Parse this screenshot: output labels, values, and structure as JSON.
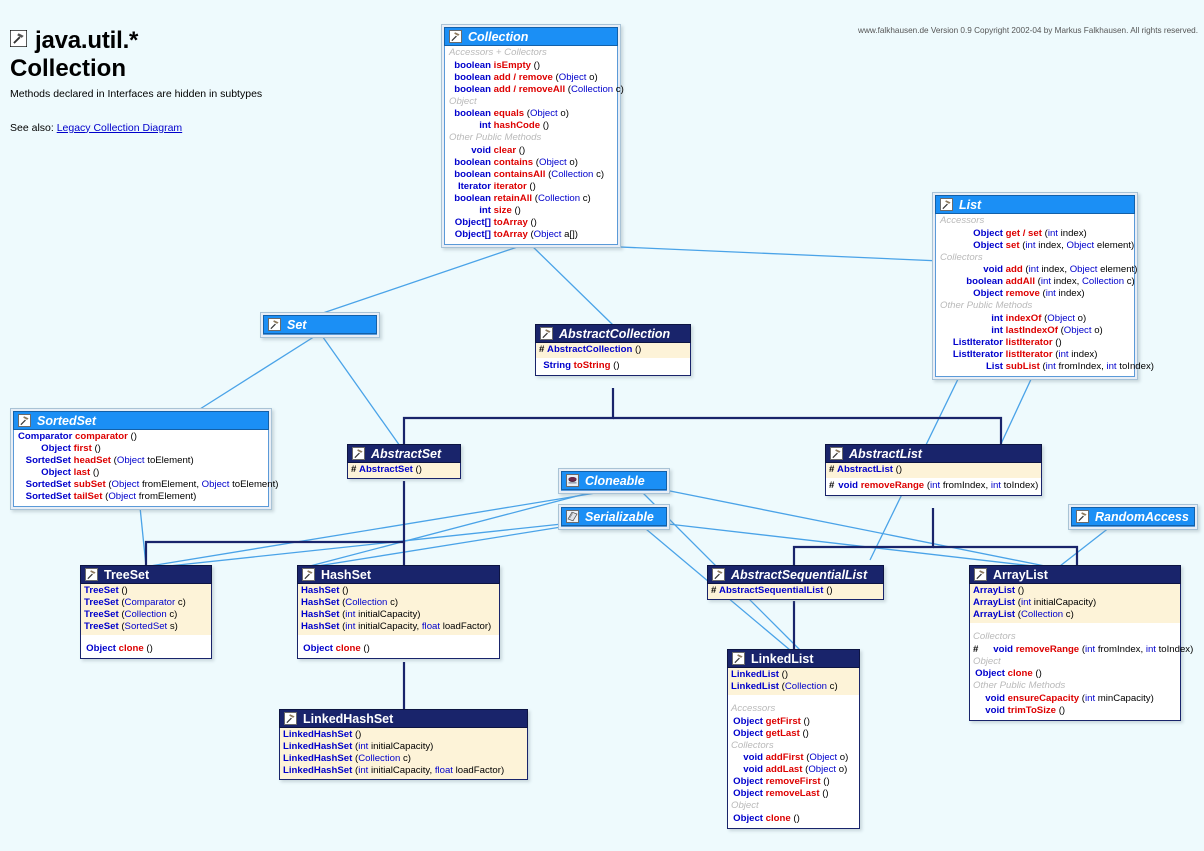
{
  "header": {
    "icon": "interface-hammer-icon",
    "title_line1": "java.util.*",
    "title_line2": "Collection",
    "subtitle": "Methods declared in Interfaces are hidden in subtypes",
    "see_also_label": "See also:",
    "see_also_link": "Legacy Collection Diagram"
  },
  "copyright": "www.falkhausen.de Version 0.9 Copyright 2002-04 by Markus Falkhausen. All rights reserved.",
  "colors": {
    "background": "#eefafd",
    "interface_header": "#1b8ff5",
    "class_header": "#19246b",
    "constructor_band": "#fdf3d8",
    "return_type": "#0000cc",
    "method_name": "#dd0000",
    "group_label": "#b9b9b9",
    "inherit_line": "#19246b",
    "implement_line": "#4aa3e8"
  },
  "boxes": {
    "collection": {
      "name": "Collection",
      "kind": "interface",
      "icon": "interface-hammer-icon",
      "rows": [
        {
          "t": "group",
          "text": "Accessors + Collectors"
        },
        {
          "t": "m",
          "ret": "boolean",
          "name": "isEmpty",
          "params": ""
        },
        {
          "t": "m",
          "ret": "boolean",
          "name": "add / remove",
          "params": "(Object o)"
        },
        {
          "t": "m",
          "ret": "boolean",
          "name": "add / removeAll",
          "params": "(Collection c)"
        },
        {
          "t": "group",
          "text": "Object"
        },
        {
          "t": "m",
          "ret": "boolean",
          "name": "equals",
          "params": "(Object o)"
        },
        {
          "t": "m",
          "ret": "int",
          "name": "hashCode",
          "params": ""
        },
        {
          "t": "group",
          "text": "Other Public Methods"
        },
        {
          "t": "m",
          "ret": "void",
          "name": "clear",
          "params": ""
        },
        {
          "t": "m",
          "ret": "boolean",
          "name": "contains",
          "params": "(Object o)"
        },
        {
          "t": "m",
          "ret": "boolean",
          "name": "containsAll",
          "params": "(Collection c)"
        },
        {
          "t": "m",
          "ret": "Iterator",
          "name": "iterator",
          "params": ""
        },
        {
          "t": "m",
          "ret": "boolean",
          "name": "retainAll",
          "params": "(Collection c)"
        },
        {
          "t": "m",
          "ret": "int",
          "name": "size",
          "params": ""
        },
        {
          "t": "m",
          "ret": "Object[]",
          "name": "toArray",
          "params": ""
        },
        {
          "t": "m",
          "ret": "Object[]",
          "name": "toArray",
          "params": "(Object a[])"
        }
      ]
    },
    "list": {
      "name": "List",
      "kind": "interface",
      "icon": "interface-hammer-icon",
      "rows": [
        {
          "t": "group",
          "text": "Accessors"
        },
        {
          "t": "m",
          "ret": "Object",
          "name": "get / set",
          "params": "(int index)"
        },
        {
          "t": "m",
          "ret": "Object",
          "name": "set",
          "params": "(int index, Object element)"
        },
        {
          "t": "group",
          "text": "Collectors"
        },
        {
          "t": "m",
          "ret": "void",
          "name": "add",
          "params": "(int index, Object element)"
        },
        {
          "t": "m",
          "ret": "boolean",
          "name": "addAll",
          "params": "(int index, Collection c)"
        },
        {
          "t": "m",
          "ret": "Object",
          "name": "remove",
          "params": "(int index)"
        },
        {
          "t": "group",
          "text": "Other Public Methods"
        },
        {
          "t": "m",
          "ret": "int",
          "name": "indexOf",
          "params": "(Object o)"
        },
        {
          "t": "m",
          "ret": "int",
          "name": "lastIndexOf",
          "params": "(Object o)"
        },
        {
          "t": "m",
          "ret": "ListIterator",
          "name": "listIterator",
          "params": ""
        },
        {
          "t": "m",
          "ret": "ListIterator",
          "name": "listIterator",
          "params": "(int index)"
        },
        {
          "t": "m",
          "ret": "List",
          "name": "subList",
          "params": "(int fromIndex, int toIndex)"
        }
      ]
    },
    "set": {
      "name": "Set",
      "kind": "interface",
      "icon": "interface-hammer-icon",
      "rows": []
    },
    "sortedset": {
      "name": "SortedSet",
      "kind": "interface",
      "icon": "interface-hammer-icon",
      "rows": [
        {
          "t": "m",
          "ret": "Comparator",
          "name": "comparator",
          "params": ""
        },
        {
          "t": "m",
          "ret": "Object",
          "name": "first",
          "params": ""
        },
        {
          "t": "m",
          "ret": "SortedSet",
          "name": "headSet",
          "params": "(Object toElement)"
        },
        {
          "t": "m",
          "ret": "Object",
          "name": "last",
          "params": ""
        },
        {
          "t": "m",
          "ret": "SortedSet",
          "name": "subSet",
          "params": "(Object fromElement, Object toElement)"
        },
        {
          "t": "m",
          "ret": "SortedSet",
          "name": "tailSet",
          "params": "(Object fromElement)"
        }
      ]
    },
    "cloneable": {
      "name": "Cloneable",
      "kind": "interface",
      "icon": "cloneable-stamp-icon",
      "rows": []
    },
    "serializable": {
      "name": "Serializable",
      "kind": "interface",
      "icon": "serializable-disk-icon",
      "rows": []
    },
    "randomaccess": {
      "name": "RandomAccess",
      "kind": "interface",
      "icon": "interface-hammer-icon",
      "rows": []
    },
    "abstractcollection": {
      "name": "AbstractCollection",
      "kind": "class",
      "icon": "class-hammer-icon",
      "ctors": [
        {
          "t": "c",
          "mod": "#",
          "name": "AbstractCollection",
          "params": "()"
        }
      ],
      "methods": [
        {
          "t": "m",
          "ret": "String",
          "name": "toString",
          "params": ""
        }
      ]
    },
    "abstractset": {
      "name": "AbstractSet",
      "kind": "class",
      "icon": "class-hammer-icon",
      "ctors": [
        {
          "t": "c",
          "mod": "#",
          "name": "AbstractSet",
          "params": "()"
        }
      ],
      "methods": []
    },
    "abstractlist": {
      "name": "AbstractList",
      "kind": "class",
      "icon": "class-hammer-icon",
      "ctors": [
        {
          "t": "c",
          "mod": "#",
          "name": "AbstractList",
          "params": "()"
        }
      ],
      "methods": [
        {
          "t": "m",
          "mod": "#",
          "ret": "void",
          "name": "removeRange",
          "params": "(int fromIndex, int toIndex)"
        }
      ]
    },
    "abstractsequentiallist": {
      "name": "AbstractSequentialList",
      "kind": "class",
      "icon": "class-hammer-icon",
      "ctors": [
        {
          "t": "c",
          "mod": "#",
          "name": "AbstractSequentialList",
          "params": "()"
        }
      ],
      "methods": []
    },
    "treeset": {
      "name": "TreeSet",
      "kind": "class",
      "icon": "class-hammer-icon",
      "ctors": [
        {
          "t": "c",
          "name": "TreeSet",
          "params": "()"
        },
        {
          "t": "c",
          "name": "TreeSet",
          "params": "(Comparator c)"
        },
        {
          "t": "c",
          "name": "TreeSet",
          "params": "(Collection c)"
        },
        {
          "t": "c",
          "name": "TreeSet",
          "params": "(SortedSet s)"
        }
      ],
      "methods": [
        {
          "t": "m",
          "ret": "Object",
          "name": "clone",
          "params": ""
        }
      ]
    },
    "hashset": {
      "name": "HashSet",
      "kind": "class",
      "icon": "class-hammer-icon",
      "ctors": [
        {
          "t": "c",
          "name": "HashSet",
          "params": "()"
        },
        {
          "t": "c",
          "name": "HashSet",
          "params": "(Collection c)"
        },
        {
          "t": "c",
          "name": "HashSet",
          "params": "(int initialCapacity)"
        },
        {
          "t": "c",
          "name": "HashSet",
          "params": "(int initialCapacity, float loadFactor)"
        }
      ],
      "methods": [
        {
          "t": "m",
          "ret": "Object",
          "name": "clone",
          "params": ""
        }
      ]
    },
    "linkedhashset": {
      "name": "LinkedHashSet",
      "kind": "class",
      "icon": "class-hammer-icon",
      "ctors": [
        {
          "t": "c",
          "name": "LinkedHashSet",
          "params": "()"
        },
        {
          "t": "c",
          "name": "LinkedHashSet",
          "params": "(int initialCapacity)"
        },
        {
          "t": "c",
          "name": "LinkedHashSet",
          "params": "(Collection c)"
        },
        {
          "t": "c",
          "name": "LinkedHashSet",
          "params": "(int initialCapacity, float loadFactor)"
        }
      ],
      "methods": []
    },
    "linkedlist": {
      "name": "LinkedList",
      "kind": "class",
      "icon": "class-hammer-icon",
      "ctors": [
        {
          "t": "c",
          "name": "LinkedList",
          "params": "()"
        },
        {
          "t": "c",
          "name": "LinkedList",
          "params": "(Collection c)"
        }
      ],
      "methods": [
        {
          "t": "group",
          "text": "Accessors"
        },
        {
          "t": "m",
          "ret": "Object",
          "name": "getFirst",
          "params": ""
        },
        {
          "t": "m",
          "ret": "Object",
          "name": "getLast",
          "params": ""
        },
        {
          "t": "group",
          "text": "Collectors"
        },
        {
          "t": "m",
          "ret": "void",
          "name": "addFirst",
          "params": "(Object o)"
        },
        {
          "t": "m",
          "ret": "void",
          "name": "addLast",
          "params": "(Object o)"
        },
        {
          "t": "m",
          "ret": "Object",
          "name": "removeFirst",
          "params": ""
        },
        {
          "t": "m",
          "ret": "Object",
          "name": "removeLast",
          "params": ""
        },
        {
          "t": "group",
          "text": "Object"
        },
        {
          "t": "m",
          "ret": "Object",
          "name": "clone",
          "params": ""
        }
      ]
    },
    "arraylist": {
      "name": "ArrayList",
      "kind": "class",
      "icon": "class-hammer-icon",
      "ctors": [
        {
          "t": "c",
          "name": "ArrayList",
          "params": "()"
        },
        {
          "t": "c",
          "name": "ArrayList",
          "params": "(int initialCapacity)"
        },
        {
          "t": "c",
          "name": "ArrayList",
          "params": "(Collection c)"
        }
      ],
      "methods": [
        {
          "t": "group",
          "text": "Collectors"
        },
        {
          "t": "m",
          "mod": "#",
          "ret": "void",
          "name": "removeRange",
          "params": "(int fromIndex, int toIndex)"
        },
        {
          "t": "group",
          "text": "Object"
        },
        {
          "t": "m",
          "ret": "Object",
          "name": "clone",
          "params": ""
        },
        {
          "t": "group",
          "text": "Other Public Methods"
        },
        {
          "t": "m",
          "ret": "void",
          "name": "ensureCapacity",
          "params": "(int minCapacity)"
        },
        {
          "t": "m",
          "ret": "void",
          "name": "trimToSize",
          "params": ""
        }
      ]
    }
  }
}
